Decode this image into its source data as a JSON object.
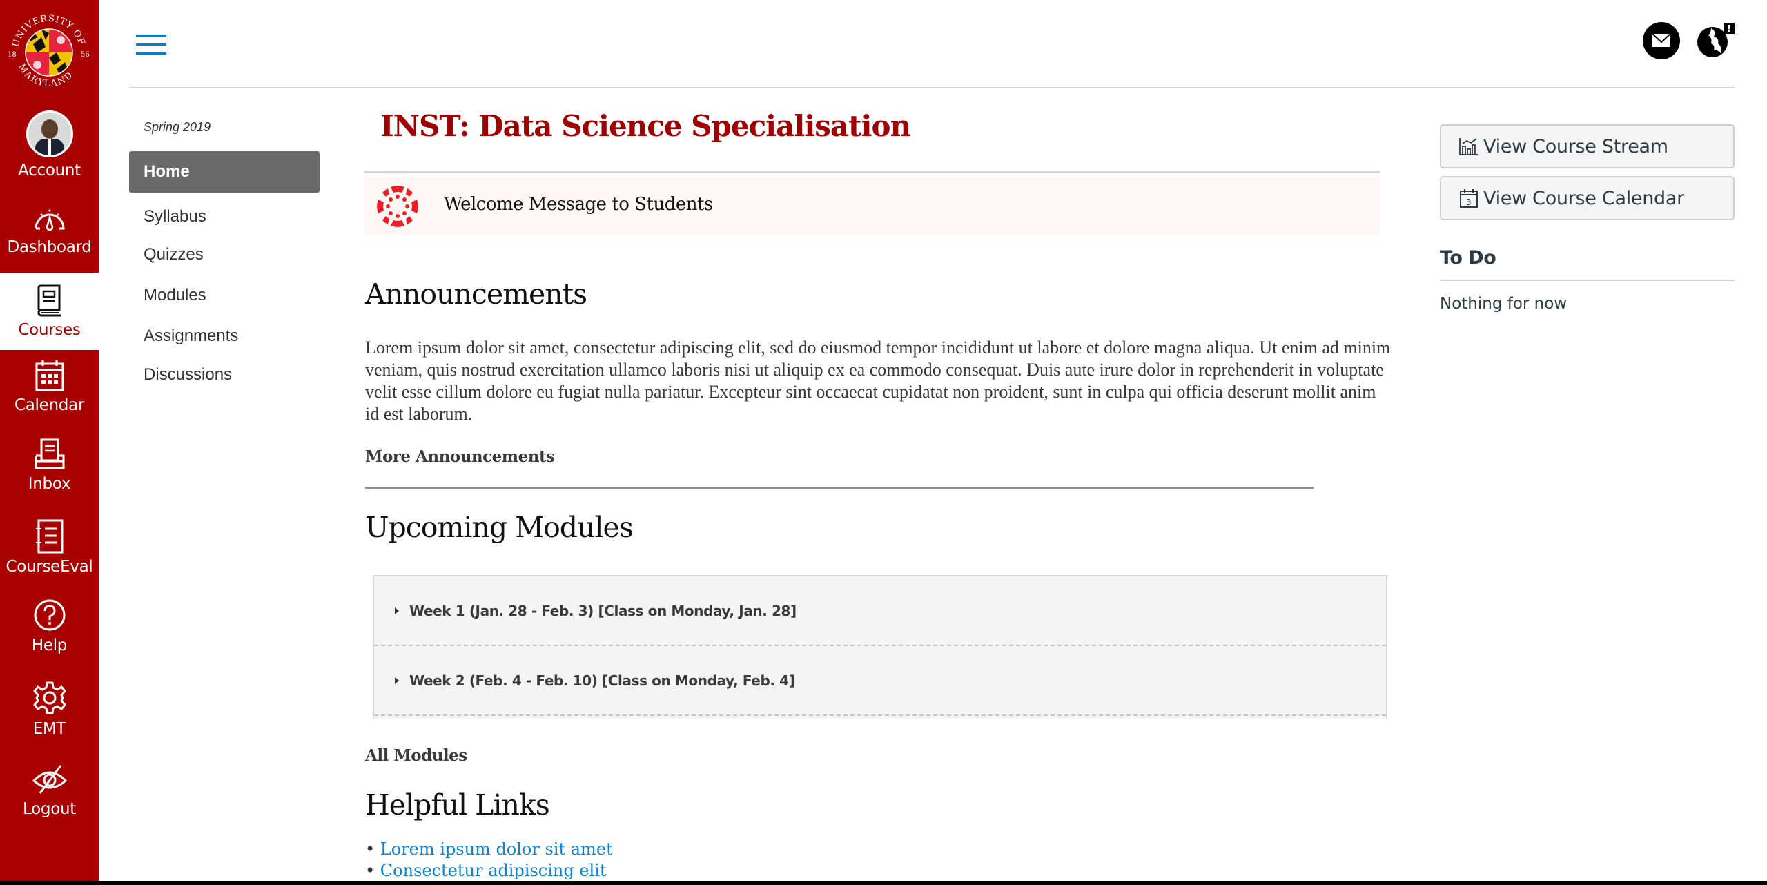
{
  "global_nav": {
    "logo_alt": "University of Maryland 1856",
    "account": {
      "label": "Account"
    },
    "items": [
      {
        "label": "Dashboard",
        "icon": "dashboard-gauge-icon"
      },
      {
        "label": "Courses",
        "icon": "courses-book-icon",
        "active": true
      },
      {
        "label": "Calendar",
        "icon": "calendar-icon"
      },
      {
        "label": "Inbox",
        "icon": "inbox-icon"
      },
      {
        "label": "CourseEval",
        "icon": "course-eval-icon"
      },
      {
        "label": "Help",
        "icon": "help-question-icon"
      },
      {
        "label": "EMT",
        "icon": "gear-icon"
      },
      {
        "label": "Logout",
        "icon": "eye-slash-icon"
      }
    ],
    "colors": {
      "background": "#a90000",
      "active_bg": "#ffffff",
      "active_text": "#a90000"
    }
  },
  "header": {
    "menu_icon": "hamburger-icon",
    "right_icons": [
      "mail-icon",
      "globe-alert-icon"
    ],
    "globe_badge": "!"
  },
  "course_nav": {
    "term": "Spring 2019",
    "items": [
      {
        "label": "Home",
        "active": true
      },
      {
        "label": "Syllabus"
      },
      {
        "label": "Quizzes"
      },
      {
        "label": "Modules"
      },
      {
        "label": "Assignments"
      },
      {
        "label": "Discussions"
      }
    ]
  },
  "main": {
    "course_title": "INST: Data Science Specialisation",
    "welcome_banner": "Welcome Message to Students",
    "announcements": {
      "heading": "Announcements",
      "body": "Lorem ipsum dolor sit amet, consectetur adipiscing elit, sed do eiusmod tempor incididunt ut labore et dolore magna aliqua. Ut enim ad minim veniam, quis nostrud exercitation ullamco laboris nisi ut aliquip ex ea commodo consequat. Duis aute irure dolor in reprehenderit in voluptate velit esse cillum dolore eu fugiat nulla pariatur. Excepteur sint occaecat cupidatat non proident, sunt in culpa qui officia deserunt mollit anim id est laborum.",
      "more_link": "More Announcements"
    },
    "upcoming_modules": {
      "heading": "Upcoming Modules",
      "items": [
        "Week 1 (Jan. 28 - Feb. 3) [Class on Monday, Jan. 28]",
        "Week 2 (Feb. 4 - Feb. 10) [Class on Monday, Feb. 4]"
      ],
      "all_link": "All Modules"
    },
    "helpful_links": {
      "heading": "Helpful Links",
      "bullet": "•",
      "items": [
        "Lorem ipsum dolor sit amet",
        "Consectetur adipiscing elit"
      ]
    },
    "colors": {
      "title": "#a00000",
      "link": "#0a84d6",
      "banner_bg": "#fff6f6"
    }
  },
  "right_sidebar": {
    "buttons": [
      {
        "label": "View Course Stream",
        "icon": "stream-chart-icon"
      },
      {
        "label": "View Course Calendar",
        "icon": "calendar-day-icon",
        "icon_text": "3"
      }
    ],
    "todo": {
      "title": "To Do",
      "empty": "Nothing for now"
    }
  }
}
